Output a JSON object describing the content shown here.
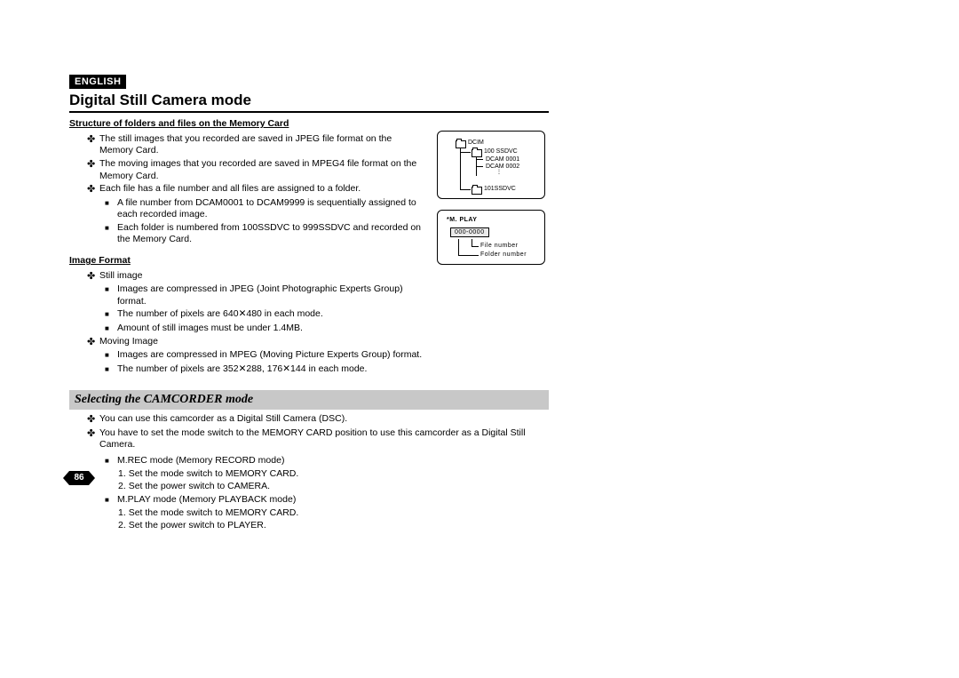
{
  "header": {
    "language": "ENGLISH",
    "title": "Digital Still Camera mode"
  },
  "section1": {
    "heading": "Structure of folders and files on the Memory Card",
    "items": [
      "The still images that you recorded are saved in JPEG file format on the Memory Card.",
      "The moving images that you recorded are saved in MPEG4 file format on the Memory Card.",
      "Each file has a file number and all files are assigned to a folder."
    ],
    "sub": [
      "A file number from DCAM0001 to DCAM9999 is sequentially assigned to each recorded image.",
      "Each folder is numbered from 100SSDVC to 999SSDVC and recorded on the Memory Card."
    ]
  },
  "section2": {
    "heading": "Image Format",
    "still_label": "Still image",
    "still_items": [
      "Images are compressed in JPEG (Joint Photographic Experts Group) format.",
      "The number of pixels are 640✕480 in each mode.",
      "Amount of still images must be under 1.4MB."
    ],
    "moving_label": "Moving Image",
    "moving_items": [
      "Images are compressed in MPEG (Moving Picture Experts Group) format.",
      "The number of pixels are 352✕288, 176✕144 in each mode."
    ]
  },
  "section3": {
    "heading": "Selecting the CAMCORDER mode",
    "intro": [
      "You can use this camcorder as a Digital Still Camera (DSC).",
      "You have to set the mode switch to the MEMORY CARD position to use this camcorder as a Digital Still Camera."
    ],
    "mrec_label": "M.REC mode (Memory RECORD mode)",
    "mrec_steps": [
      "Set the mode switch to MEMORY CARD.",
      "Set the power switch to CAMERA."
    ],
    "mplay_label": "M.PLAY mode (Memory PLAYBACK mode)",
    "mplay_steps": [
      "Set the mode switch to MEMORY CARD.",
      "Set the power switch to PLAYER."
    ]
  },
  "diagram1": {
    "dcim": "DCIM",
    "f1": "100 SSDVC",
    "f2": "DCAM 0001",
    "f3": "DCAM 0002",
    "f4": "101SSDVC"
  },
  "diagram2": {
    "title": "*M. PLAY",
    "code": "000-0000",
    "l1": "File number",
    "l2": "Folder number"
  },
  "page_number": "86"
}
